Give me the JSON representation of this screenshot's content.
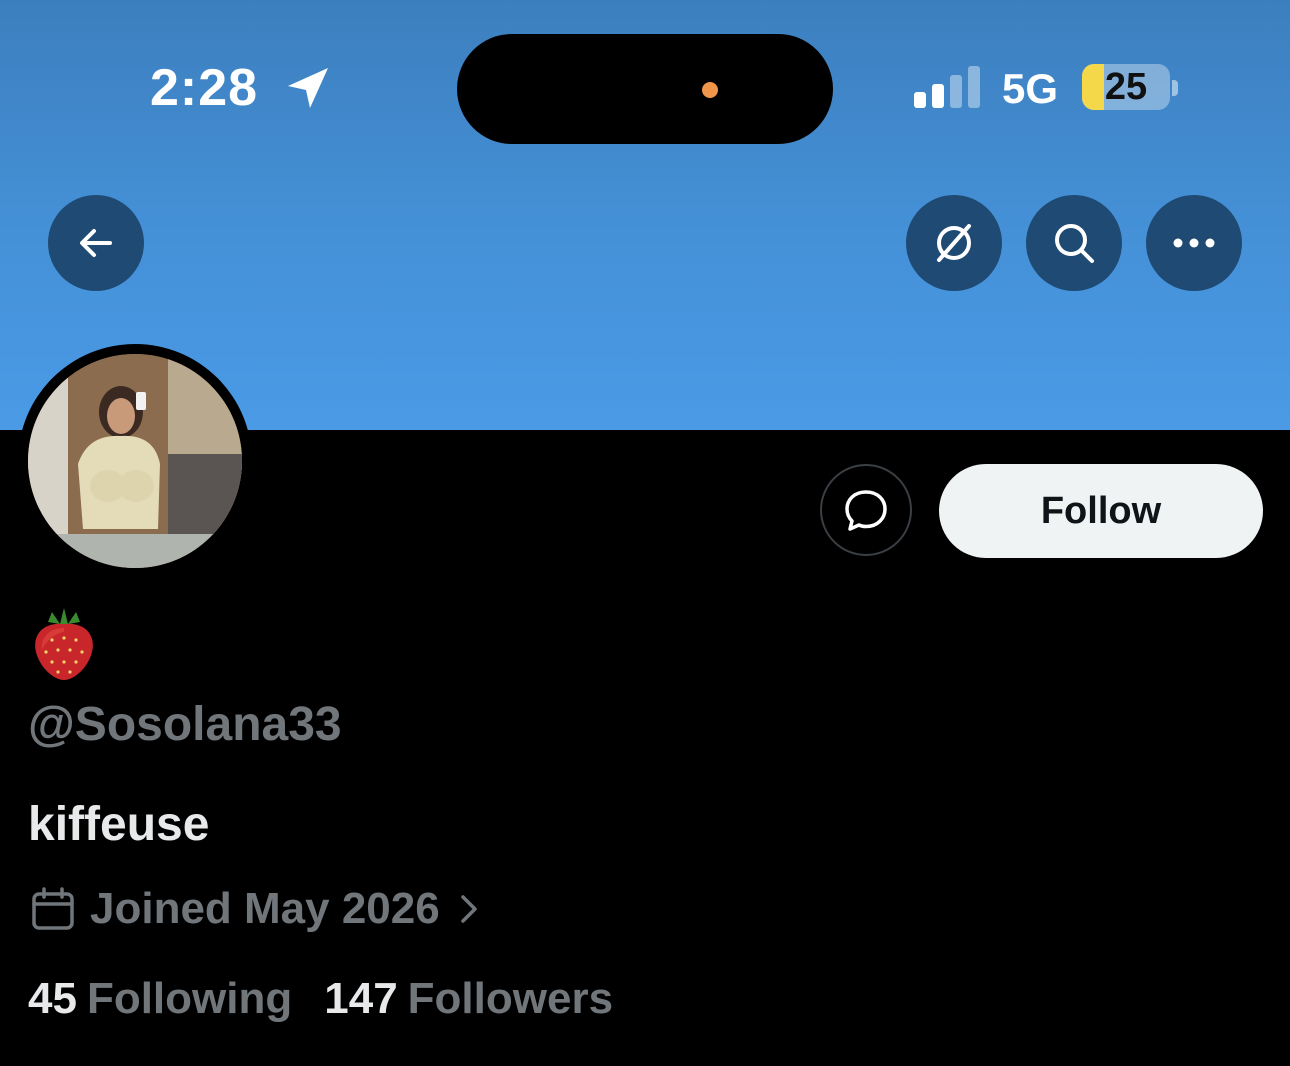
{
  "status_bar": {
    "time": "2:28",
    "network": "5G",
    "battery": "25",
    "battery_level_percent": 25
  },
  "header": {
    "back_icon": "arrow-left-icon",
    "grok_icon": "grok-slash-circle-icon",
    "search_icon": "search-icon",
    "more_icon": "more-horizontal-icon"
  },
  "actions": {
    "message_icon": "chat-bubble-icon",
    "follow_label": "Follow"
  },
  "profile": {
    "display_name_icon": "strawberry-emoji",
    "handle": "@Sosolana33",
    "bio": "kiffeuse",
    "joined": "Joined May 2026",
    "following_count": "45",
    "following_label": "Following",
    "followers_count": "147",
    "followers_label": "Followers"
  },
  "colors": {
    "banner": "#4591d8",
    "background": "#000000",
    "muted_text": "#71767b",
    "primary_text": "#e7e9ea"
  }
}
